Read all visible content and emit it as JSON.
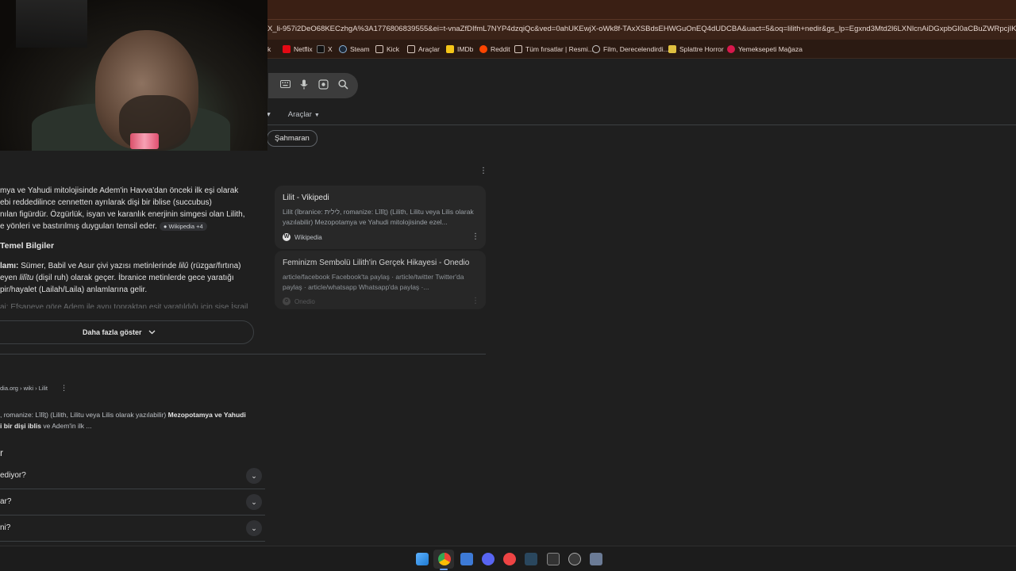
{
  "browser": {
    "url": "X_li-957i2DeO68KECzhgA%3A1776806839555&ei=t-vnaZfDIfmL7NYP4dzqiQc&ved=0ahUKEwjX-oWk8f-TAxXSBdsEHWGuOnEQ4dUDCBA&uact=5&oq=lilith+nedir&gs_lp=Egxnd3Mtd2l6LXNlcnAiDGxpbGl0aCBuZWRpcjIKEAAYRxjWBBiwAzIKEAAYRxjWBBiwAzIKEAAYRxjWBB",
    "bookmarks": [
      "Netflix",
      "X",
      "Steam",
      "Kick",
      "Araçlar",
      "IMDb",
      "Reddit",
      "Tüm fırsatlar | Resmi...",
      "Film, Derecelendirdi...",
      "Splattre Horror",
      "Yemeksepeti Mağaza"
    ],
    "bookmark_leading_fragment": "k"
  },
  "search": {
    "tools_label": "Araçlar",
    "chip_label": "Şahmaran"
  },
  "ai_overview": {
    "lines": [
      "mya ve Yahudi mitolojisinde Adem'in Havva'dan önceki ilk eşi olarak",
      "ebi reddedilince cennetten ayrılarak dişi bir iblise (succubus)",
      "nılan figürdür. Özgürlük, isyan ve karanlık enerjinin simgesi olan Lilith,",
      "e yönleri ve bastırılmış duyguları temsil eder."
    ],
    "source_tag": "Wikipedia +4",
    "section_title": "Temel Bilgiler",
    "bullet_bold": "lamı:",
    "bullet_l1_a": " Sümer, Babil ve Asur çivi yazısı metinlerinde ",
    "bullet_l1_ital": "lilû",
    "bullet_l1_b": " (rüzgar/fırtına)",
    "bullet_l2_a": "eyen ",
    "bullet_l2_ital": "lilîtu",
    "bullet_l2_b": " (dişil ruh) olarak geçer. İbranice metinlerde gece yaratığı",
    "bullet_l3": "pir/hayalet (Lailah/Laila) anlamlarına gelir.",
    "faded_line": "aj: Efsaneye göre Adem ile aynı topraktan eşit yaratıldığı için şişe İsrail",
    "more_button": "Daha fazla göster"
  },
  "source_cards": [
    {
      "title": "Lilit - Vikipedi",
      "snippet": "Lilit (İbranice: לילית, romanize: Lîlîṯ) (Lilith, Lilitu veya Lilis olarak yazılabilir) Mezopotamya ve Yahudi mitolojisinde ezel...",
      "source": "Wikipedia",
      "icon_letter": "W"
    },
    {
      "title": "Feminizm Sembolü Lilith'in Gerçek Hikayesi - Onedio",
      "snippet": "article/facebook Facebook'ta paylaş · article/twitter Twitter'da paylaş · article/whatsapp Whatsapp'da paylaş ·...",
      "source": "Onedio",
      "icon_letter": "o"
    }
  ],
  "web_result": {
    "breadcrumb": "dia.org › wiki › Lilit",
    "snippet_l1_a": ", romanize: Lîlîṯ) (Lilith, Lilitu veya Lilis olarak yazılabilir) ",
    "snippet_l1_b": "Mezopotamya ve Yahudi",
    "snippet_l2_a": "i bir dişi iblis",
    "snippet_l2_b": " ve Adem'in ilk ..."
  },
  "people_also_ask": {
    "title": "r",
    "questions": [
      "ediyor?",
      "ar?",
      "ni?"
    ]
  },
  "taskbar": {
    "apps": [
      "start",
      "chrome",
      "mail",
      "discord",
      "youtube-music",
      "steam",
      "epic-games",
      "obs",
      "app"
    ]
  }
}
